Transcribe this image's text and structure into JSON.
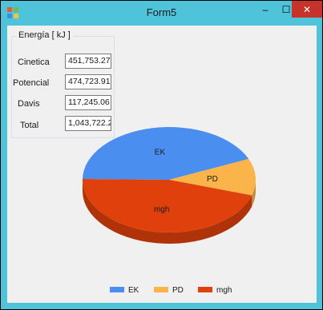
{
  "window": {
    "title": "Form5",
    "minimize_glyph": "‒",
    "maximize_glyph": "☐",
    "close_glyph": "✕",
    "titlebar_color": "#4fc3d9",
    "close_color": "#c7332b"
  },
  "energy_group": {
    "title": "Energía [ kJ ]",
    "rows": [
      {
        "label": "Cinetica",
        "value": "451,753.27"
      },
      {
        "label": "Potencial",
        "value": "474,723.91"
      },
      {
        "label": "Davis",
        "value": "117,245.06"
      },
      {
        "label": "Total",
        "value": "1,043,722.2"
      }
    ]
  },
  "chart_data": {
    "type": "pie",
    "style": "3d",
    "slices": [
      {
        "name": "EK",
        "value": 451753.27,
        "color": "#4a8ff0"
      },
      {
        "name": "PD",
        "value": 117245.06,
        "color": "#fbb44a"
      },
      {
        "name": "mgh",
        "value": 474723.91,
        "color": "#e0400c"
      }
    ],
    "legend": {
      "position": "bottom",
      "entries": [
        "EK",
        "PD",
        "mgh"
      ]
    }
  }
}
